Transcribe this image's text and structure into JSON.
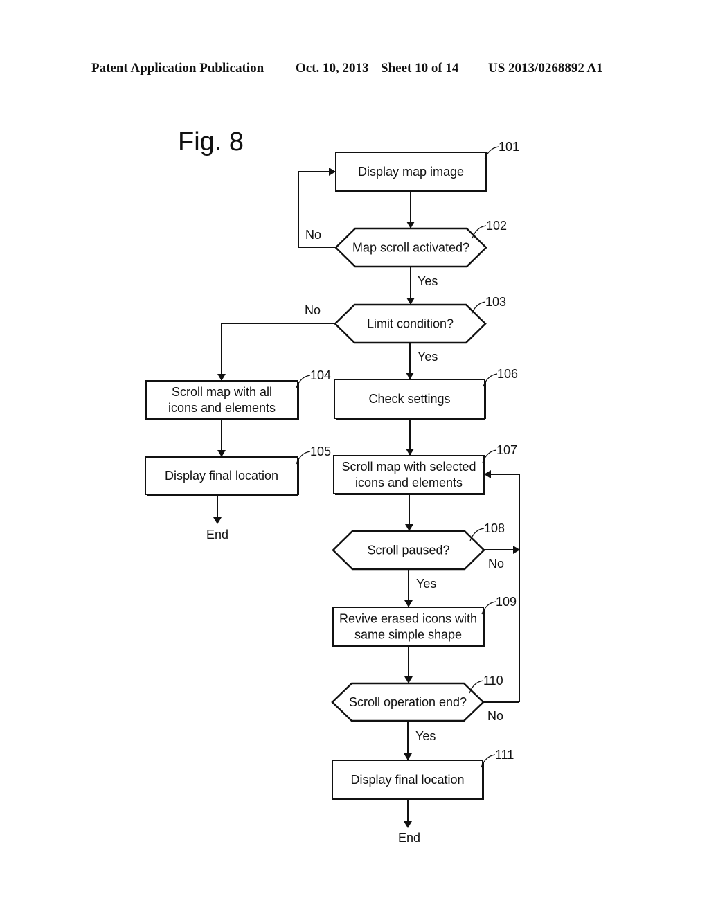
{
  "header": {
    "publication": "Patent Application Publication",
    "date": "Oct. 10, 2013",
    "sheet": "Sheet 10 of 14",
    "number": "US 2013/0268892 A1"
  },
  "figure": {
    "title": "Fig. 8"
  },
  "nodes": {
    "n101": {
      "ref": "101",
      "shape": "process",
      "lines": [
        "Display map image"
      ]
    },
    "n102": {
      "ref": "102",
      "shape": "decision",
      "lines": [
        "Map scroll activated?"
      ]
    },
    "n103": {
      "ref": "103",
      "shape": "decision",
      "lines": [
        "Limit condition?"
      ]
    },
    "n104": {
      "ref": "104",
      "shape": "process",
      "lines": [
        "Scroll map with all",
        "icons and elements"
      ]
    },
    "n105": {
      "ref": "105",
      "shape": "process",
      "lines": [
        "Display final location"
      ]
    },
    "n106": {
      "ref": "106",
      "shape": "process",
      "lines": [
        "Check settings"
      ]
    },
    "n107": {
      "ref": "107",
      "shape": "process",
      "lines": [
        "Scroll map with selected",
        "icons and elements"
      ]
    },
    "n108": {
      "ref": "108",
      "shape": "decision",
      "lines": [
        "Scroll paused?"
      ]
    },
    "n109": {
      "ref": "109",
      "shape": "process",
      "lines": [
        "Revive erased icons with",
        "same simple shape"
      ]
    },
    "n110": {
      "ref": "110",
      "shape": "decision",
      "lines": [
        "Scroll operation end?"
      ]
    },
    "n111": {
      "ref": "111",
      "shape": "process",
      "lines": [
        "Display final location"
      ]
    }
  },
  "terminals": {
    "end_left": "End",
    "end_right": "End"
  },
  "edges": [
    {
      "from": "n101",
      "to": "n102",
      "label": ""
    },
    {
      "from": "n102",
      "to": "n101",
      "label": "No"
    },
    {
      "from": "n102",
      "to": "n103",
      "label": "Yes"
    },
    {
      "from": "n103",
      "to": "n104",
      "label": "No"
    },
    {
      "from": "n103",
      "to": "n106",
      "label": "Yes"
    },
    {
      "from": "n104",
      "to": "n105",
      "label": ""
    },
    {
      "from": "n105",
      "to": "end_left",
      "label": ""
    },
    {
      "from": "n106",
      "to": "n107",
      "label": ""
    },
    {
      "from": "n107",
      "to": "n108",
      "label": ""
    },
    {
      "from": "n108",
      "to": "n107",
      "label": "No"
    },
    {
      "from": "n108",
      "to": "n109",
      "label": "Yes"
    },
    {
      "from": "n109",
      "to": "n110",
      "label": ""
    },
    {
      "from": "n110",
      "to": "n107",
      "label": "No"
    },
    {
      "from": "n110",
      "to": "n111",
      "label": "Yes"
    },
    {
      "from": "n111",
      "to": "end_right",
      "label": ""
    }
  ]
}
